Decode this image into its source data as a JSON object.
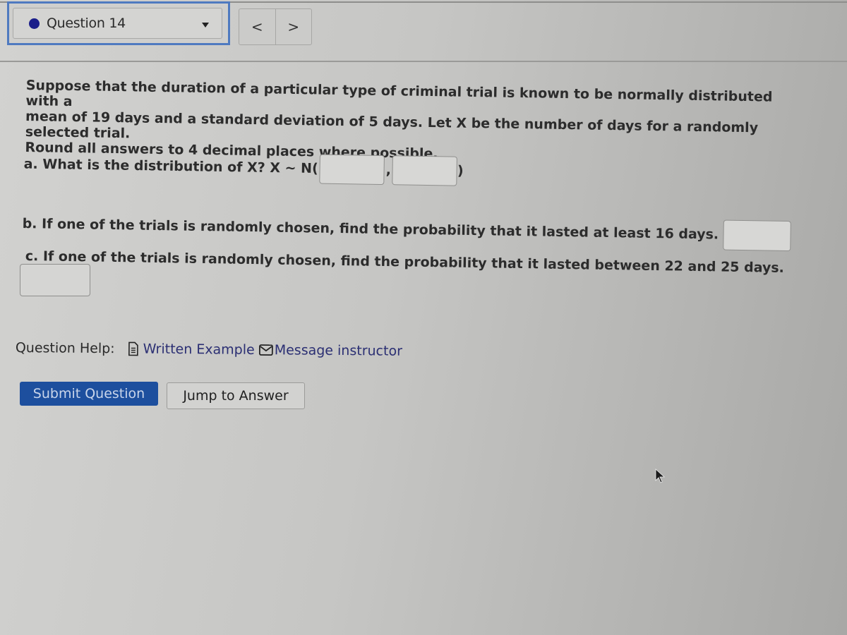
{
  "question_nav": {
    "selected_question": "Question 14",
    "status_dot_color": "#1b1e8a",
    "prev_label": "<",
    "next_label": ">"
  },
  "problem": {
    "lines": [
      "Suppose that the duration of a particular type of criminal trial is known to be normally distributed with a",
      "mean of 19 days and a standard deviation of 5 days. Let X be the number of days for a randomly selected trial.",
      "Round all answers to 4 decimal places where possible."
    ]
  },
  "parts": {
    "a": {
      "prompt": "a. What is the distribution of X? X ~ N(",
      "separator": ",",
      "closing": ")",
      "mean_value": "",
      "sd_value": ""
    },
    "b": {
      "prompt": "b. If one of the trials is randomly chosen, find the probability that it lasted at least 16 days.",
      "value": ""
    },
    "c": {
      "prompt": "c. If one of the trials is randomly chosen, find the probability that it lasted between 22 and 25 days.",
      "value": ""
    }
  },
  "help": {
    "label": "Question Help:",
    "links": [
      {
        "label": "Written Example",
        "icon": "document-icon"
      },
      {
        "label": "Message instructor",
        "icon": "envelope-icon"
      }
    ]
  },
  "actions": {
    "submit_label": "Submit Question",
    "jump_label": "Jump to Answer",
    "submit_color": "#1d4f9e"
  }
}
